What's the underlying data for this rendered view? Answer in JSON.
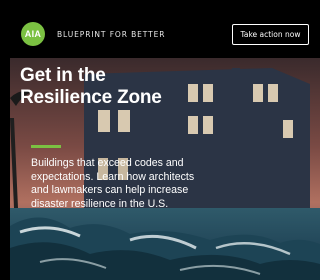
{
  "brand": {
    "logo_text": "AIA",
    "tagline": "BLUEPRINT FOR BETTER",
    "accent_color": "#7bc142"
  },
  "cta": {
    "label": "Take action now"
  },
  "hero": {
    "headline": "Get in the Resilience Zone",
    "body": "Buildings that exceed codes and expectations. Learn how architects and lawmakers can help increase disaster resilience in the U.S."
  }
}
